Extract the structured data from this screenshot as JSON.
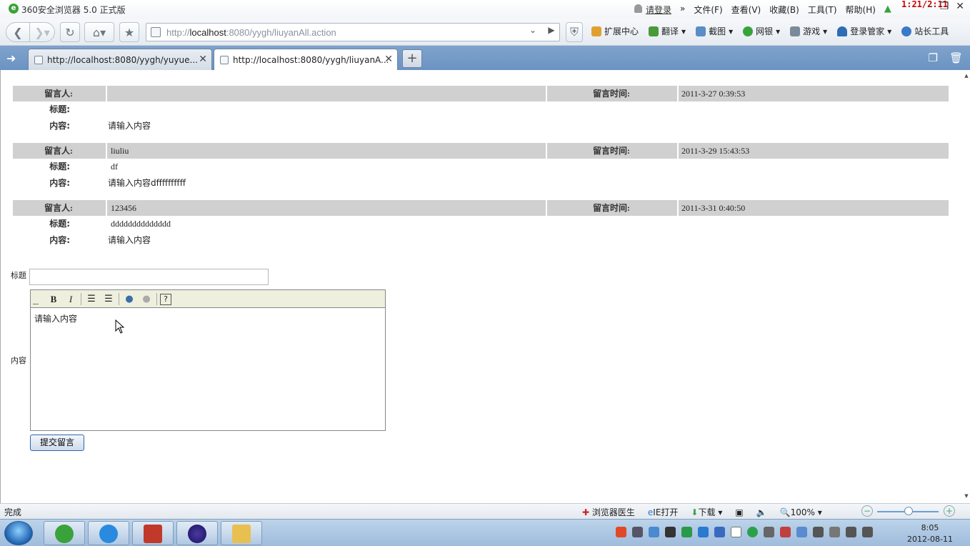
{
  "window": {
    "title": "360安全浏览器 5.0 正式版",
    "login_link": "请登录",
    "menus": [
      "文件(F)",
      "查看(V)",
      "收藏(B)",
      "工具(T)",
      "帮助(H)"
    ],
    "overlay_clock": "1:21/2:11"
  },
  "address_bar": {
    "url_prefix": "http://",
    "url_host": "localhost",
    "url_rest": ":8080/yygh/liuyanAll.action"
  },
  "toolbar": {
    "items": [
      "扩展中心",
      "翻译",
      "截图",
      "网银",
      "游戏",
      "登录管家",
      "站长工具"
    ]
  },
  "tabs": [
    {
      "label": "http://localhost:8080/yygh/yuyue..."
    },
    {
      "label": "http://localhost:8080/yygh/liuyanA..."
    }
  ],
  "labels": {
    "author": "留言人:",
    "time": "留言时间:",
    "title": "标题:",
    "content": "内容:"
  },
  "messages": [
    {
      "author": "",
      "time": "2011-3-27 0:39:53",
      "title": "",
      "content": "请输入内容"
    },
    {
      "author": "liuliu",
      "time": "2011-3-29 15:43:53",
      "title": "df",
      "content": "请输入内容dffffffffff"
    },
    {
      "author": "123456",
      "time": "2011-3-31 0:40:50",
      "title": "dddddddddddddd",
      "content": "请输入内容"
    }
  ],
  "form": {
    "title_label": "标题",
    "title_value": "",
    "content_label": "内容",
    "editor_text": "请输入内容",
    "submit_label": "提交留言"
  },
  "status": {
    "text": "完成",
    "items": [
      "浏览器医生",
      "IE打开",
      "下载"
    ],
    "zoom": "100%"
  },
  "taskbar": {
    "time": "8:05",
    "date": "2012-08-11"
  }
}
